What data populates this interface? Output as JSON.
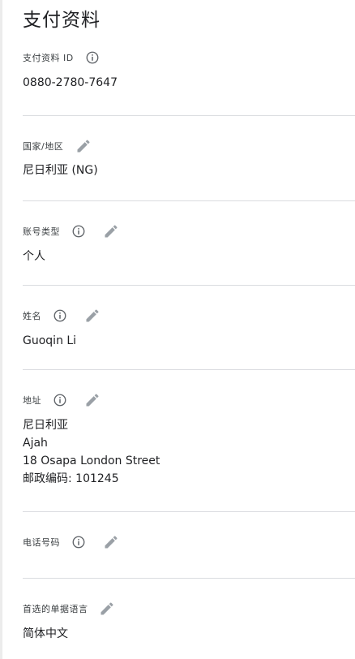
{
  "page": {
    "title": "支付资料"
  },
  "fields": {
    "payment_id": {
      "label": "支付资料 ID",
      "value": "0880-2780-7647"
    },
    "country": {
      "label": "国家/地区",
      "value": "尼日利亚 (NG)"
    },
    "account_type": {
      "label": "账号类型",
      "value": "个人"
    },
    "name": {
      "label": "姓名",
      "value": "Guoqin Li"
    },
    "address": {
      "label": "地址",
      "lines": [
        "尼日利亚",
        "Ajah",
        "18 Osapa London Street",
        "邮政编码: 101245"
      ]
    },
    "phone": {
      "label": "电话号码",
      "value": ""
    },
    "invoice_language": {
      "label": "首选的单据语言",
      "value": "简体中文"
    }
  },
  "icons": {
    "info": "info-circle-icon",
    "edit": "pencil-icon"
  },
  "colors": {
    "icon": "#9aa0a6",
    "divider": "#dadce0",
    "text": "#202124"
  }
}
